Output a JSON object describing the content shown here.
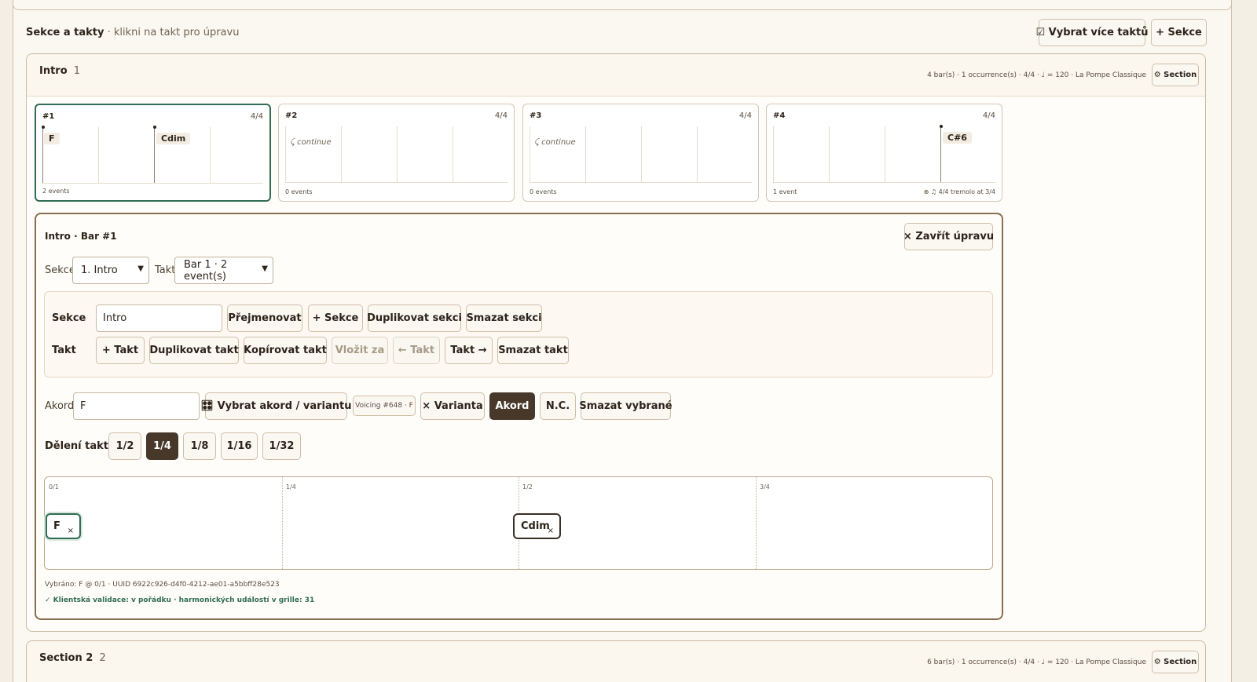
{
  "header": {
    "title": "Sekce a takty",
    "hint": "· klikni na takt pro úpravu",
    "select_multiple_label": "☑ Vybrat více taktů",
    "add_section_label": "+ Sekce"
  },
  "sections": [
    {
      "name": "Intro",
      "index": "1",
      "meta": "4 bar(s) · 1 occurrence(s) · 4/4 · ♩ = 120 · La Pompe Classique",
      "settings_label": "⚙ Section"
    },
    {
      "name": "Section 2",
      "index": "2",
      "meta": "6 bar(s) · 1 occurrence(s) · 4/4 · ♩ = 120 · La Pompe Classique",
      "settings_label": "⚙ Section"
    }
  ],
  "bars": [
    {
      "num": "#1",
      "sig": "4/4",
      "chords": [
        {
          "label": "F",
          "beat": 0
        },
        {
          "label": "Cdim",
          "beat": 2
        }
      ],
      "continue": "",
      "footer": "2 events",
      "footer_right": ""
    },
    {
      "num": "#2",
      "sig": "4/4",
      "chords": [],
      "continue": "⤹ continue",
      "footer": "0 events",
      "footer_right": ""
    },
    {
      "num": "#3",
      "sig": "4/4",
      "chords": [],
      "continue": "⤹ continue",
      "footer": "0 events",
      "footer_right": ""
    },
    {
      "num": "#4",
      "sig": "4/4",
      "chords": [
        {
          "label": "C#6",
          "beat": 3
        }
      ],
      "continue": "",
      "footer": "1 event",
      "footer_right": "⊕ ♫ 4/4 tremolo at 3/4"
    }
  ],
  "editor": {
    "title": "Intro · Bar #1",
    "close_label": "× Zavřít úpravu",
    "section_label": "Sekce",
    "section_value": "1. Intro",
    "bar_label": "Takt",
    "bar_value": "Bar 1 · 2 event(s)",
    "toolbox": {
      "section_row_label": "Sekce",
      "section_name_value": "Intro",
      "rename": "Přejmenovat",
      "add_section": "+ Sekce",
      "duplicate_section": "Duplikovat sekci",
      "delete_section": "Smazat sekci",
      "bar_row_label": "Takt",
      "add_bar": "+ Takt",
      "duplicate_bar": "Duplikovat takt",
      "copy_bar": "Kopírovat takt",
      "insert_after": "Vložit za",
      "move_left": "← Takt",
      "move_right": "Takt →",
      "delete_bar": "Smazat takt"
    },
    "chord": {
      "label": "Akord",
      "value": "F",
      "pick_label": "🎛 Vybrat akord / variantu",
      "voicing_badge": "Voicing #648 · F",
      "variant_label": "× Varianta",
      "chord_label": "Akord",
      "nc_label": "N.C.",
      "delete_selected": "Smazat vybrané"
    },
    "division": {
      "label": "Dělení taktu:",
      "options": [
        "1/2",
        "1/4",
        "1/8",
        "1/16",
        "1/32"
      ],
      "selected": "1/4"
    },
    "timeline": {
      "marks": [
        "0/1",
        "1/4",
        "1/2",
        "3/4"
      ],
      "chips": [
        {
          "label": "F",
          "pos": "0/1",
          "close": "×",
          "selected": true
        },
        {
          "label": "Cdim",
          "pos": "1/2",
          "close": "×",
          "selected": false
        }
      ]
    },
    "selected_info": "Vybráno: F @ 0/1 · UUID 6922c926-d4f0-4212-ae01-a5bbff28e523",
    "validation": "✓ Klientská validace: v pořádku · harmonických událostí v grille: 31"
  },
  "colors": {
    "accent_dark": "#47382a",
    "selected_green": "#2f6b55",
    "validation_green": "#2f6b55"
  }
}
